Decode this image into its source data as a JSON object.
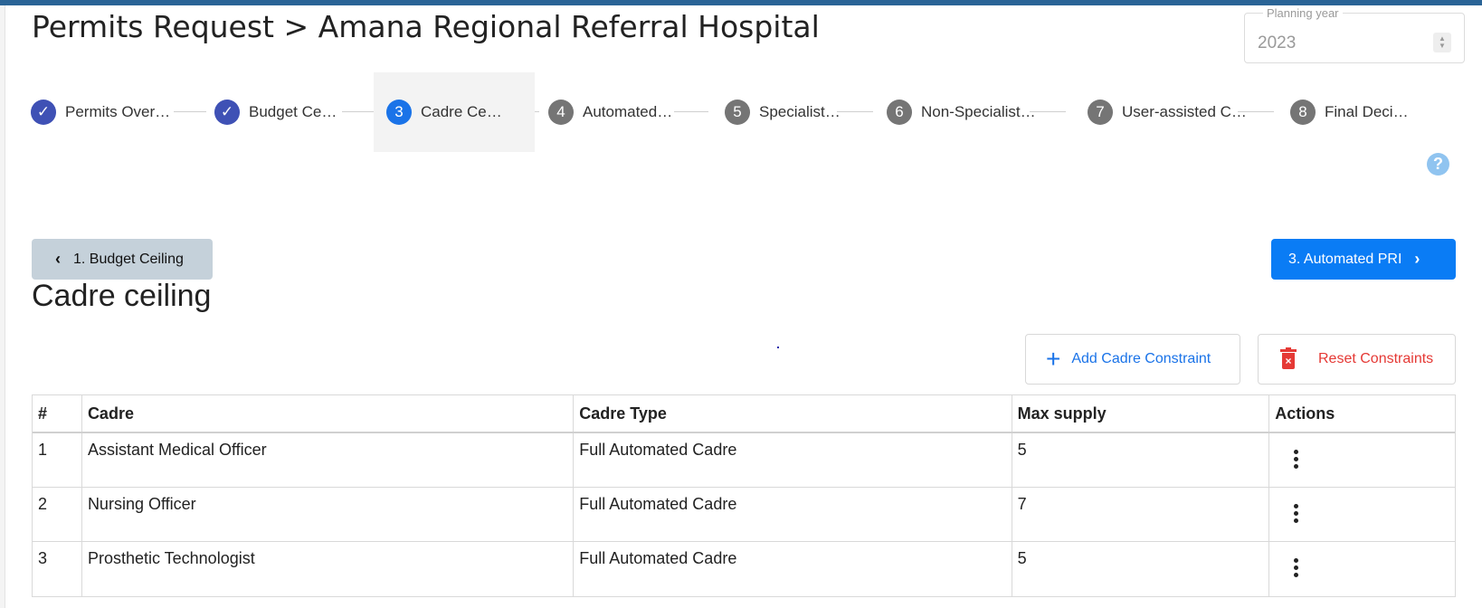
{
  "header": {
    "title": "Permits Request > Amana Regional Referral Hospital"
  },
  "planning_year": {
    "label": "Planning year",
    "value": "2023"
  },
  "stepper": {
    "steps": [
      {
        "number": "1",
        "label": "Permits Over…",
        "state": "done"
      },
      {
        "number": "2",
        "label": "Budget Ce…",
        "state": "done"
      },
      {
        "number": "3",
        "label": "Cadre Ce…",
        "state": "current"
      },
      {
        "number": "4",
        "label": "Automated…",
        "state": "todo"
      },
      {
        "number": "5",
        "label": "Specialist…",
        "state": "todo"
      },
      {
        "number": "6",
        "label": "Non-Specialist…",
        "state": "todo"
      },
      {
        "number": "7",
        "label": "User-assisted C…",
        "state": "todo"
      },
      {
        "number": "8",
        "label": "Final Deci…",
        "state": "todo"
      }
    ]
  },
  "help": {
    "glyph": "?"
  },
  "navigation": {
    "back_label": "1. Budget Ceiling",
    "next_label": "3. Automated PRI"
  },
  "section": {
    "title": "Cadre ceiling",
    "add_label": "Add Cadre Constraint",
    "reset_label": "Reset Constraints"
  },
  "table": {
    "columns": [
      "#",
      "Cadre",
      "Cadre Type",
      "Max supply",
      "Actions"
    ],
    "rows": [
      {
        "num": "1",
        "cadre": "Assistant Medical Officer",
        "type": "Full Automated Cadre",
        "max": "5"
      },
      {
        "num": "2",
        "cadre": "Nursing Officer",
        "type": "Full Automated Cadre",
        "max": "7"
      },
      {
        "num": "3",
        "cadre": "Prosthetic Technologist",
        "type": "Full Automated Cadre",
        "max": "5"
      }
    ]
  },
  "colors": {
    "accent": "#0a7cf5",
    "done_step": "#3f51b5",
    "danger": "#e53935",
    "top_bar": "#2a6496"
  }
}
